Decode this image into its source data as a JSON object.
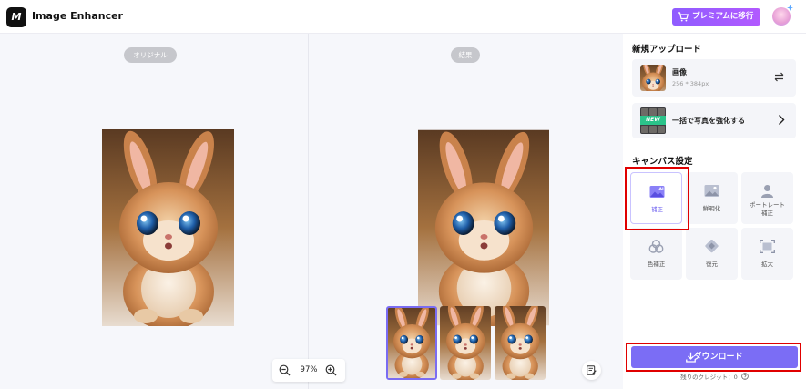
{
  "app": {
    "title": "Image Enhancer",
    "logo_text": "M",
    "premium_label": "プレミアムに移行",
    "brand_color": "#7b6df5"
  },
  "preview": {
    "original_label": "オリジナル",
    "result_label": "結果",
    "zoom": "97%",
    "thumbnails": [
      "variant-1",
      "variant-2",
      "variant-3"
    ],
    "selected_thumbnail": 0
  },
  "side": {
    "new_upload_title": "新規アップロード",
    "file": {
      "name": "画像",
      "size": "256 * 384px"
    },
    "batch": {
      "badge": "NEW",
      "label": "一括で写真を強化する"
    },
    "canvas_title": "キャンバス設定",
    "tools": [
      {
        "label": "補正",
        "icon": "ai-image-icon",
        "active": true
      },
      {
        "label": "鮮明化",
        "icon": "image-icon",
        "active": false
      },
      {
        "label": "ポートレート\n補正",
        "icon": "portrait-icon",
        "active": false
      },
      {
        "label": "色補正",
        "icon": "color-circles-icon",
        "active": false
      },
      {
        "label": "復元",
        "icon": "restore-icon",
        "active": false
      },
      {
        "label": "拡大",
        "icon": "expand-icon",
        "active": false
      }
    ],
    "download_label": "ダウンロード",
    "credits_label": "残りのクレジット：0"
  }
}
